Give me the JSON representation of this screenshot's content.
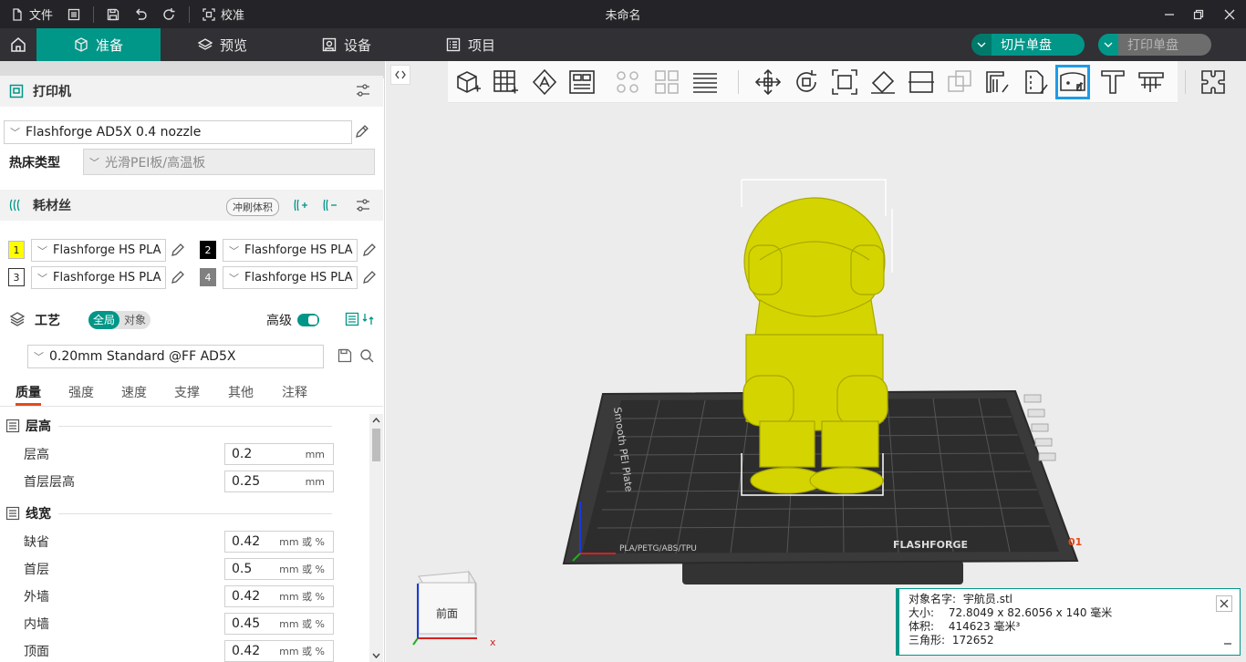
{
  "titlebar": {
    "file_label": "文件",
    "calibrate_label": "校准",
    "window_title": "未命名"
  },
  "nav": {
    "tabs": [
      {
        "label": "准备",
        "icon": "cube-icon"
      },
      {
        "label": "预览",
        "icon": "layers-icon"
      },
      {
        "label": "设备",
        "icon": "monitor-icon"
      },
      {
        "label": "项目",
        "icon": "list-icon"
      }
    ],
    "slice_label": "切片单盘",
    "print_label": "打印单盘"
  },
  "printer": {
    "section_title": "打印机",
    "profile": "Flashforge AD5X 0.4 nozzle",
    "bed_type_label": "热床类型",
    "bed_type_value": "光滑PEI板/高温板"
  },
  "filament": {
    "section_title": "耗材丝",
    "flush_label": "冲刷体积",
    "slots": [
      {
        "num": "1",
        "color": "#ffff00",
        "text_color": "#222222",
        "name": "Flashforge HS PLA"
      },
      {
        "num": "2",
        "color": "#000000",
        "text_color": "#ffffff",
        "name": "Flashforge HS PLA"
      },
      {
        "num": "3",
        "color": "#ffffff",
        "text_color": "#222222",
        "name": "Flashforge HS PLA"
      },
      {
        "num": "4",
        "color": "#808080",
        "text_color": "#ffffff",
        "name": "Flashforge HS PLA"
      }
    ]
  },
  "process": {
    "section_title": "工艺",
    "scope_global": "全局",
    "scope_object": "对象",
    "advanced_label": "高级",
    "profile": "0.20mm Standard @FF AD5X",
    "tabs": [
      "质量",
      "强度",
      "速度",
      "支撑",
      "其他",
      "注释"
    ],
    "groups": [
      {
        "title": "层高",
        "params": [
          {
            "label": "层高",
            "value": "0.2",
            "unit": "mm"
          },
          {
            "label": "首层层高",
            "value": "0.25",
            "unit": "mm"
          }
        ]
      },
      {
        "title": "线宽",
        "params": [
          {
            "label": "缺省",
            "value": "0.42",
            "unit": "mm 或 %"
          },
          {
            "label": "首层",
            "value": "0.5",
            "unit": "mm 或 %"
          },
          {
            "label": "外墙",
            "value": "0.42",
            "unit": "mm 或 %"
          },
          {
            "label": "内墙",
            "value": "0.45",
            "unit": "mm 或 %"
          },
          {
            "label": "顶面",
            "value": "0.42",
            "unit": "mm 或 %"
          }
        ]
      }
    ]
  },
  "viewport": {
    "view_cube_label": "前面",
    "axis_x": "x",
    "model_color": "#d4d400",
    "plate_text_left": "Smooth PEI Plate",
    "plate_text_bottom": "PLA/PETG/ABS/TPU",
    "plate_brand": "FLASHFORGE",
    "plate_number": "01",
    "object_info": {
      "name_label": "对象名字:",
      "name": "宇航员.stl",
      "size_label": "大小:",
      "size": "72.8049 x 82.6056 x 140 毫米",
      "volume_label": "体积:",
      "volume": "414623 毫米³",
      "triangles_label": "三角形:",
      "triangles": "172652"
    }
  }
}
